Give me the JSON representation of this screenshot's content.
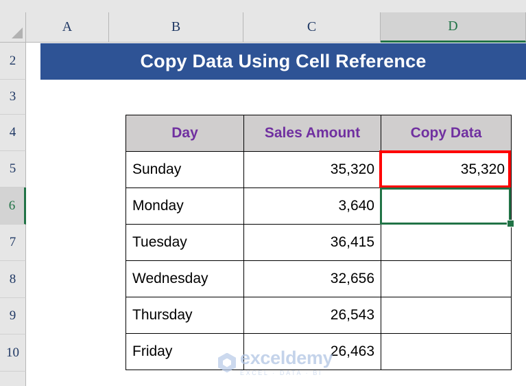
{
  "app": {
    "type": "spreadsheet",
    "select_all_icon": "select-all-triangle-icon"
  },
  "columns": [
    {
      "label": "A",
      "active": false
    },
    {
      "label": "B",
      "active": false
    },
    {
      "label": "C",
      "active": false
    },
    {
      "label": "D",
      "active": true
    }
  ],
  "rows": [
    {
      "label": "2",
      "active": false
    },
    {
      "label": "3",
      "active": false
    },
    {
      "label": "4",
      "active": false
    },
    {
      "label": "5",
      "active": false
    },
    {
      "label": "6",
      "active": true
    },
    {
      "label": "7",
      "active": false
    },
    {
      "label": "8",
      "active": false
    },
    {
      "label": "9",
      "active": false
    },
    {
      "label": "10",
      "active": false
    }
  ],
  "banner": {
    "text": "Copy Data Using Cell Reference",
    "background": "#2E5395",
    "text_color": "#FFFFFF"
  },
  "table": {
    "headers": [
      "Day",
      "Sales Amount",
      "Copy Data"
    ],
    "header_background": "#D0CECE",
    "header_text_color": "#7030A0",
    "rows": [
      {
        "day": "Sunday",
        "sales": "35,320",
        "copy": "35,320"
      },
      {
        "day": "Monday",
        "sales": "3,640",
        "copy": ""
      },
      {
        "day": "Tuesday",
        "sales": "36,415",
        "copy": ""
      },
      {
        "day": "Wednesday",
        "sales": "32,656",
        "copy": ""
      },
      {
        "day": "Thursday",
        "sales": "26,543",
        "copy": ""
      },
      {
        "day": "Friday",
        "sales": "26,463",
        "copy": ""
      }
    ]
  },
  "annotations": {
    "highlight_box": {
      "target": "D5",
      "color": "#FF0000"
    },
    "selection": {
      "target": "D6",
      "color": "#217346",
      "handle": "fill-handle"
    }
  },
  "watermark": {
    "name": "exceldemy",
    "tagline": "EXCEL · DATA · BI",
    "color": "#AEC3E3"
  }
}
